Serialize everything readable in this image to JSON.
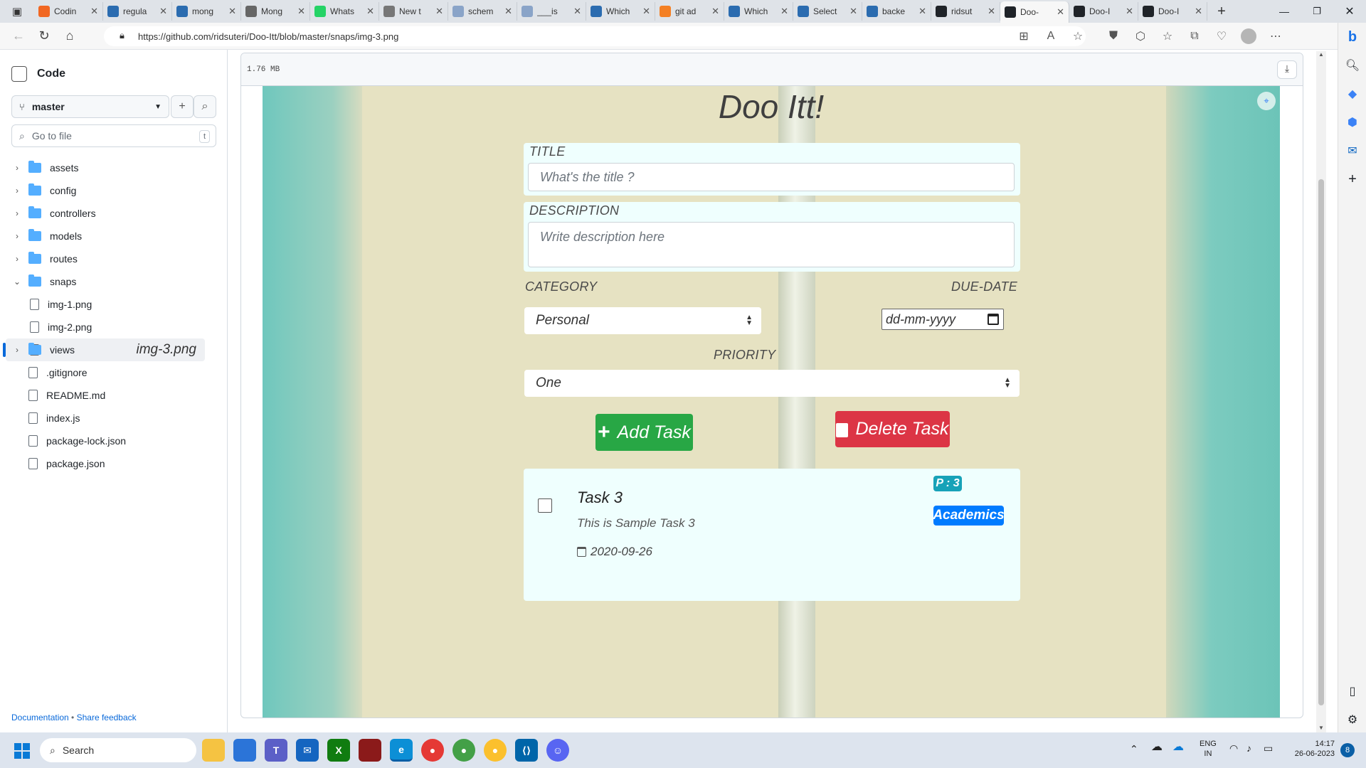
{
  "browser": {
    "tabs": [
      {
        "label": "Codin",
        "icon": "coding-site-icon",
        "color": "#f16722"
      },
      {
        "label": "regula",
        "icon": "search-icon",
        "color": "#2b6cb0"
      },
      {
        "label": "mong",
        "icon": "search-icon",
        "color": "#2b6cb0"
      },
      {
        "label": "Mong",
        "icon": "globe-icon",
        "color": "#666666"
      },
      {
        "label": "Whats",
        "icon": "whatsapp-icon",
        "color": "#25d366"
      },
      {
        "label": "New t",
        "icon": "new-tab-icon",
        "color": "#777777"
      },
      {
        "label": "schem",
        "icon": "search-icon",
        "color": "#8aa4c8"
      },
      {
        "label": "___is",
        "icon": "search-icon",
        "color": "#8aa4c8"
      },
      {
        "label": "Which",
        "icon": "search-icon",
        "color": "#2b6cb0"
      },
      {
        "label": "git ad",
        "icon": "stackoverflow-icon",
        "color": "#f48024"
      },
      {
        "label": "Which",
        "icon": "search-icon",
        "color": "#2b6cb0"
      },
      {
        "label": "Select",
        "icon": "search-icon",
        "color": "#2b6cb0"
      },
      {
        "label": "backe",
        "icon": "search-icon",
        "color": "#2b6cb0"
      },
      {
        "label": "ridsut",
        "icon": "github-icon",
        "color": "#1f2328"
      },
      {
        "label": "Doo-",
        "icon": "github-icon",
        "color": "#1f2328"
      },
      {
        "label": "Doo-I",
        "icon": "github-icon",
        "color": "#1f2328"
      },
      {
        "label": "Doo-I",
        "icon": "github-icon",
        "color": "#1f2328"
      }
    ],
    "url": "https://github.com/ridsuteri/Doo-Itt/blob/master/snaps/img-3.png"
  },
  "sidebar": {
    "title": "Code",
    "branch": "master",
    "go_to_file": "Go to file",
    "shortcut": "t",
    "tree": [
      {
        "name": "assets",
        "type": "folder",
        "expanded": false,
        "depth": 0
      },
      {
        "name": "config",
        "type": "folder",
        "expanded": false,
        "depth": 0
      },
      {
        "name": "controllers",
        "type": "folder",
        "expanded": false,
        "depth": 0
      },
      {
        "name": "models",
        "type": "folder",
        "expanded": false,
        "depth": 0
      },
      {
        "name": "routes",
        "type": "folder",
        "expanded": false,
        "depth": 0
      },
      {
        "name": "snaps",
        "type": "folder",
        "expanded": true,
        "depth": 0
      },
      {
        "name": "img-1.png",
        "type": "file",
        "depth": 1
      },
      {
        "name": "img-2.png",
        "type": "file",
        "depth": 1
      },
      {
        "name": "img-3.png",
        "type": "file",
        "depth": 1,
        "selected": true
      },
      {
        "name": "views",
        "type": "folder",
        "expanded": false,
        "depth": 0
      },
      {
        "name": ".gitignore",
        "type": "file",
        "depth": 0
      },
      {
        "name": "README.md",
        "type": "file",
        "depth": 0
      },
      {
        "name": "index.js",
        "type": "file",
        "depth": 0
      },
      {
        "name": "package-lock.json",
        "type": "file",
        "depth": 0
      },
      {
        "name": "package.json",
        "type": "file",
        "depth": 0
      }
    ],
    "footer_doc": "Documentation",
    "footer_sep": " • ",
    "footer_feedback": "Share feedback"
  },
  "viewer": {
    "file_size": "1.76 MB"
  },
  "app": {
    "title": "Doo Itt!",
    "title_label": "TITLE",
    "title_placeholder": "What's the title ?",
    "desc_label": "DESCRIPTION",
    "desc_placeholder": "Write description here",
    "category_label": "CATEGORY",
    "category_value": "Personal",
    "due_label": "DUE-DATE",
    "due_placeholder": "dd-mm-yyyy",
    "priority_label": "PRIORITY",
    "priority_value": "One",
    "add_button": "Add Task",
    "delete_button": "Delete Task",
    "task": {
      "title": "Task 3",
      "description": "This is Sample Task 3",
      "date": "2020-09-26",
      "priority_badge": "P : 3",
      "category_badge": "Academics"
    },
    "colors": {
      "add": "#28a745",
      "delete": "#dc3545",
      "badge": "#17a2b8",
      "category_badge": "#007bff"
    }
  },
  "taskbar": {
    "search": "Search",
    "lang": "ENG",
    "region": "IN",
    "time": "14:17",
    "date": "26-06-2023",
    "notifications": "8"
  }
}
